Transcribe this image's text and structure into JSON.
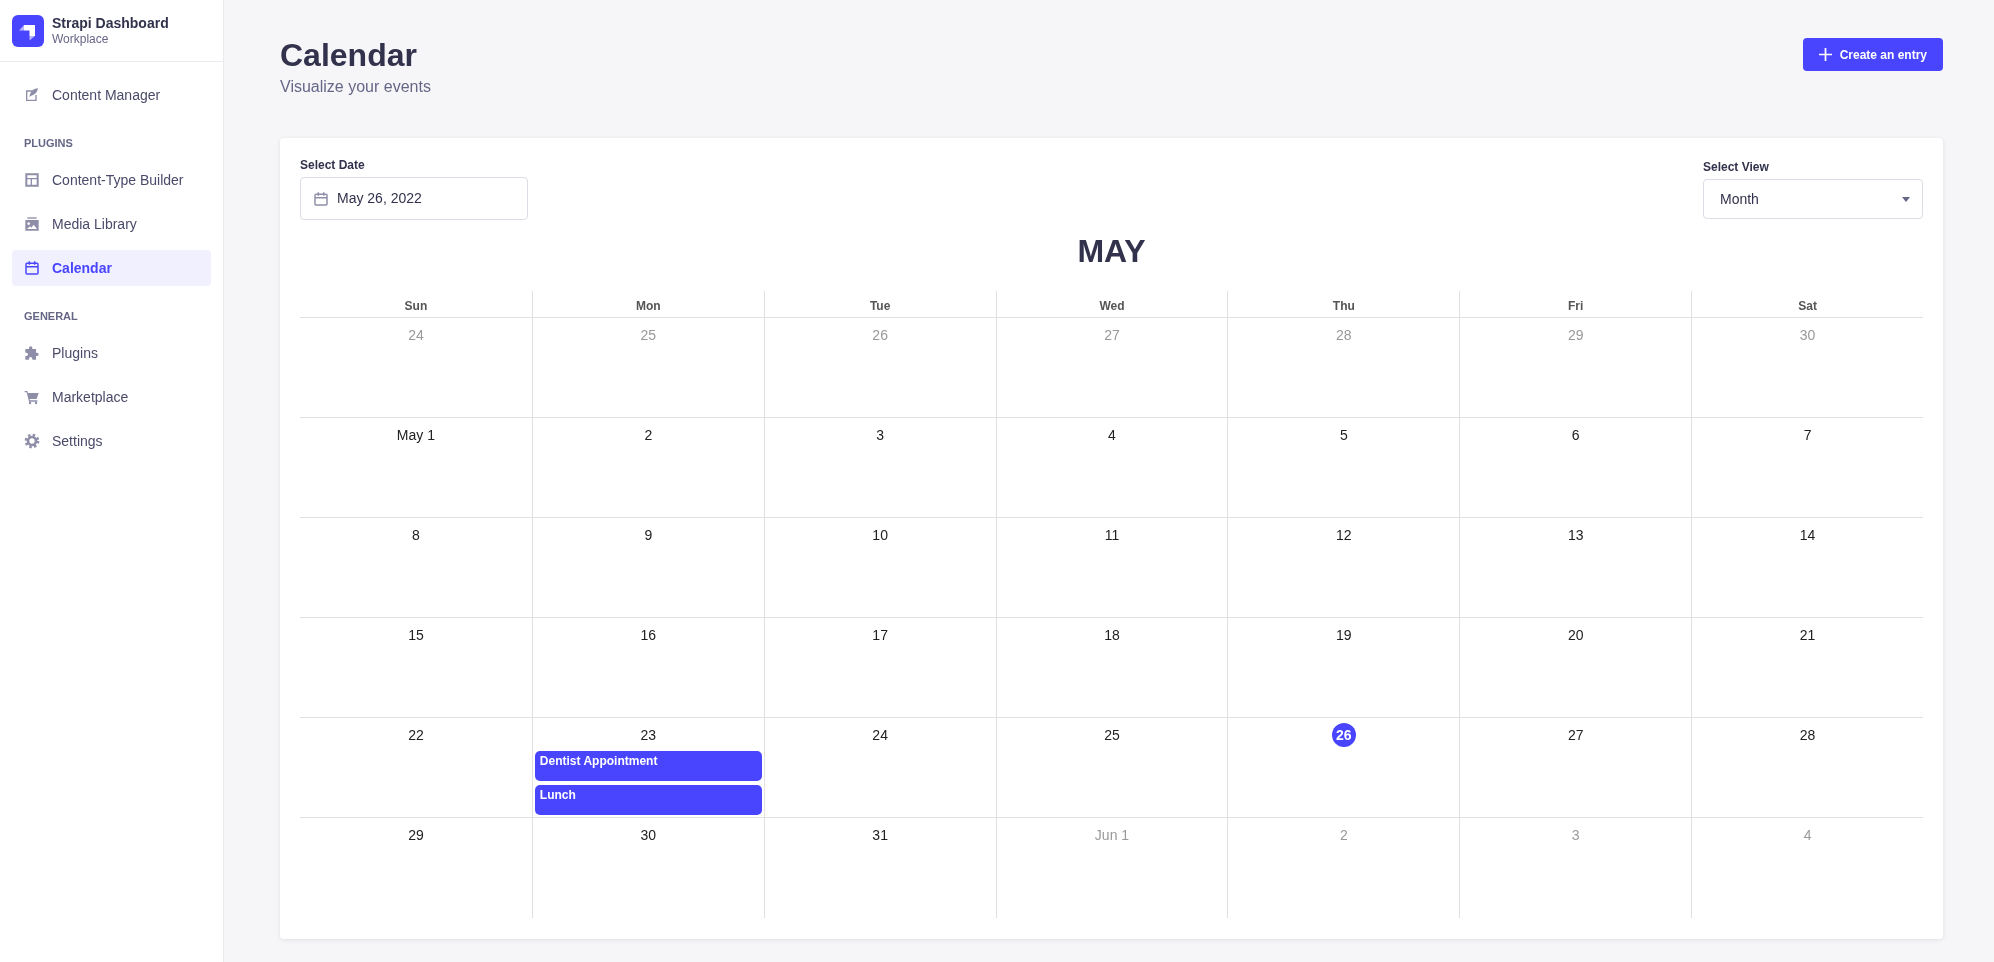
{
  "sidebar": {
    "brand": {
      "name": "Strapi Dashboard",
      "workspace": "Workplace"
    },
    "sections": [
      {
        "items": [
          {
            "label": "Content Manager",
            "selected": false
          }
        ]
      },
      {
        "heading": "PLUGINS",
        "items": [
          {
            "label": "Content-Type Builder",
            "selected": false
          },
          {
            "label": "Media Library",
            "selected": false
          },
          {
            "label": "Calendar",
            "selected": true
          }
        ]
      },
      {
        "heading": "GENERAL",
        "items": [
          {
            "label": "Plugins",
            "selected": false
          },
          {
            "label": "Marketplace",
            "selected": false
          },
          {
            "label": "Settings",
            "selected": false
          }
        ]
      }
    ]
  },
  "header": {
    "title": "Calendar",
    "subtitle": "Visualize your events",
    "action": "Create an entry"
  },
  "calendar": {
    "date_field": {
      "label": "Select Date",
      "value": "May 26, 2022"
    },
    "view_select": {
      "label": "Select View",
      "value": "Month"
    },
    "month_title": "MAY",
    "weekdays": [
      "Sun",
      "Mon",
      "Tue",
      "Wed",
      "Thu",
      "Fri",
      "Sat"
    ],
    "weeks": [
      [
        {
          "label": "24",
          "outside_month": true,
          "today": false
        },
        {
          "label": "25",
          "outside_month": true,
          "today": false
        },
        {
          "label": "26",
          "outside_month": true,
          "today": false
        },
        {
          "label": "27",
          "outside_month": true,
          "today": false
        },
        {
          "label": "28",
          "outside_month": true,
          "today": false
        },
        {
          "label": "29",
          "outside_month": true,
          "today": false
        },
        {
          "label": "30",
          "outside_month": true,
          "today": false
        }
      ],
      [
        {
          "label": "May 1",
          "outside_month": false,
          "today": false
        },
        {
          "label": "2",
          "outside_month": false,
          "today": false
        },
        {
          "label": "3",
          "outside_month": false,
          "today": false
        },
        {
          "label": "4",
          "outside_month": false,
          "today": false
        },
        {
          "label": "5",
          "outside_month": false,
          "today": false
        },
        {
          "label": "6",
          "outside_month": false,
          "today": false
        },
        {
          "label": "7",
          "outside_month": false,
          "today": false
        }
      ],
      [
        {
          "label": "8",
          "outside_month": false,
          "today": false
        },
        {
          "label": "9",
          "outside_month": false,
          "today": false
        },
        {
          "label": "10",
          "outside_month": false,
          "today": false
        },
        {
          "label": "11",
          "outside_month": false,
          "today": false
        },
        {
          "label": "12",
          "outside_month": false,
          "today": false
        },
        {
          "label": "13",
          "outside_month": false,
          "today": false
        },
        {
          "label": "14",
          "outside_month": false,
          "today": false
        }
      ],
      [
        {
          "label": "15",
          "outside_month": false,
          "today": false
        },
        {
          "label": "16",
          "outside_month": false,
          "today": false
        },
        {
          "label": "17",
          "outside_month": false,
          "today": false
        },
        {
          "label": "18",
          "outside_month": false,
          "today": false
        },
        {
          "label": "19",
          "outside_month": false,
          "today": false
        },
        {
          "label": "20",
          "outside_month": false,
          "today": false
        },
        {
          "label": "21",
          "outside_month": false,
          "today": false
        }
      ],
      [
        {
          "label": "22",
          "outside_month": false,
          "today": false
        },
        {
          "label": "23",
          "outside_month": false,
          "today": false,
          "events": [
            {
              "title": "Dentist Appointment"
            },
            {
              "title": "Lunch"
            }
          ]
        },
        {
          "label": "24",
          "outside_month": false,
          "today": false
        },
        {
          "label": "25",
          "outside_month": false,
          "today": false
        },
        {
          "label": "26",
          "outside_month": false,
          "today": true
        },
        {
          "label": "27",
          "outside_month": false,
          "today": false
        },
        {
          "label": "28",
          "outside_month": false,
          "today": false
        }
      ],
      [
        {
          "label": "29",
          "outside_month": false,
          "today": false
        },
        {
          "label": "30",
          "outside_month": false,
          "today": false
        },
        {
          "label": "31",
          "outside_month": false,
          "today": false
        },
        {
          "label": "Jun 1",
          "outside_month": true,
          "today": false
        },
        {
          "label": "2",
          "outside_month": true,
          "today": false
        },
        {
          "label": "3",
          "outside_month": true,
          "today": false
        },
        {
          "label": "4",
          "outside_month": true,
          "today": false
        }
      ]
    ]
  }
}
